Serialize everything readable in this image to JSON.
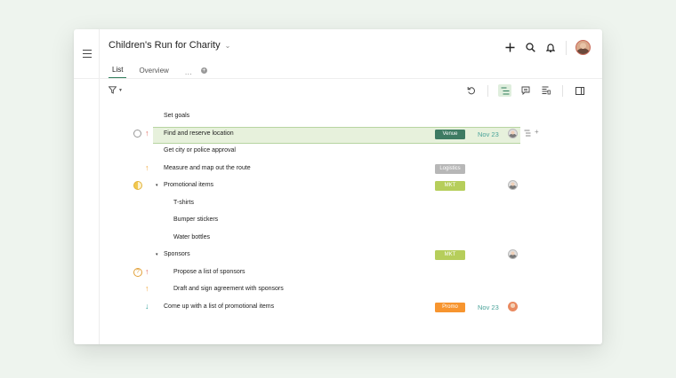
{
  "app": {
    "title": "Children's Run for Charity",
    "tabs": [
      {
        "label": "List",
        "active": true
      },
      {
        "label": "Overview",
        "active": false
      }
    ],
    "tab_more": "···",
    "tab_add": "+"
  },
  "colors": {
    "accent": "#2f7d5b",
    "selected_row": "#e7f1dc",
    "tag_venue": "#3e7b63",
    "tag_logistics": "#b7b7b7",
    "tag_mkt": "#b6ce5b",
    "tag_promo": "#f7952f"
  },
  "icons": {
    "menu": "hamburger-icon",
    "add": "plus-icon",
    "search": "search-icon",
    "notifications": "bell-icon",
    "filter": "funnel-icon"
  },
  "tasks": [
    {
      "title": "Set goals",
      "indent": 0
    },
    {
      "title": "Find and reserve location",
      "indent": 0,
      "status": "open",
      "priority": "high",
      "tag": "Venue",
      "date": "Nov 23",
      "assignee": true,
      "selected": true
    },
    {
      "title": "Get city or police approval",
      "indent": 0
    },
    {
      "title": "Measure and map out the route",
      "indent": 0,
      "priority": "medium",
      "tag": "Logistics"
    },
    {
      "title": "Promotional items",
      "indent": 0,
      "expander": "▾",
      "status": "half",
      "tag": "MKT",
      "assignee": true
    },
    {
      "title": "T-shirts",
      "indent": 1
    },
    {
      "title": "Bumper stickers",
      "indent": 1
    },
    {
      "title": "Water bottles",
      "indent": 1
    },
    {
      "title": "Sponsors",
      "indent": 0,
      "expander": "▾",
      "tag": "MKT",
      "assignee": true
    },
    {
      "title": "Propose a list of sponsors",
      "indent": 1,
      "status": "question",
      "priority": "high"
    },
    {
      "title": "Draft and sign agreement with sponsors",
      "indent": 1,
      "priority": "medium"
    },
    {
      "title": "Come up with a list of promotional items",
      "indent": 0,
      "priority": "low",
      "tag": "Promo",
      "date": "Nov 23",
      "assignee": true
    }
  ],
  "glyphs": {
    "priority_high": "↑",
    "priority_medium": "↑",
    "priority_low": "↓",
    "status_question": "?",
    "row_add": "+"
  }
}
